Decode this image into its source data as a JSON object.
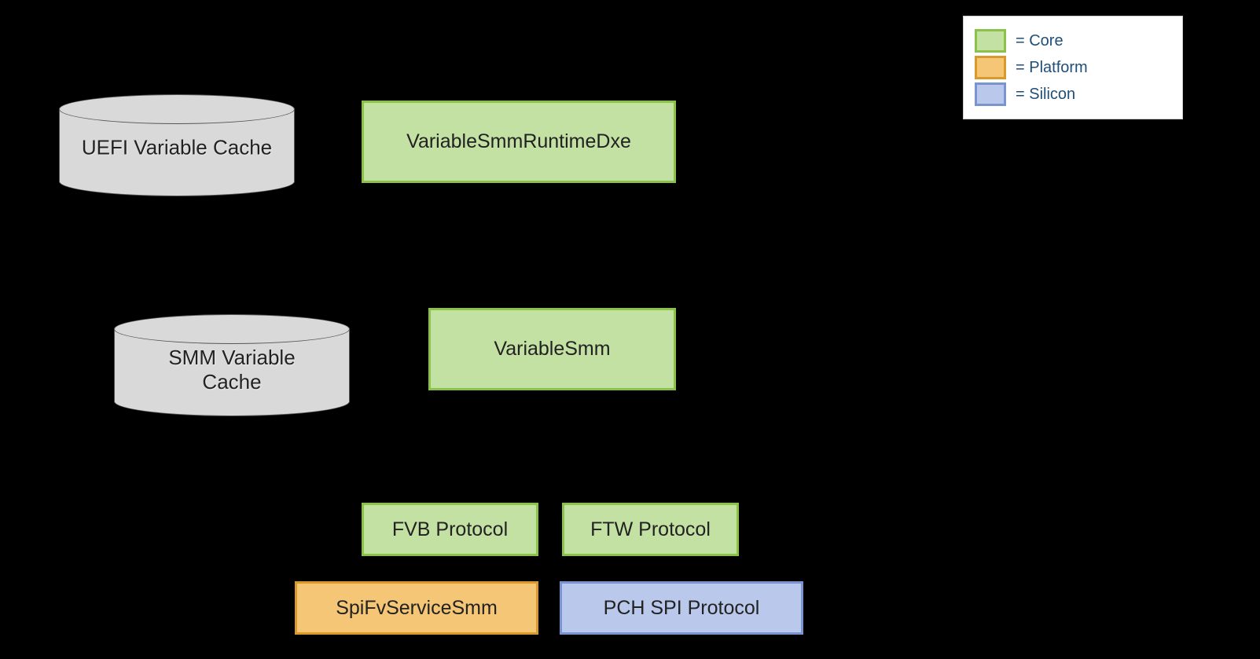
{
  "cylinders": {
    "uefi_cache": "UEFI Variable Cache",
    "smm_cache_line1": "SMM Variable",
    "smm_cache_line2": "Cache"
  },
  "boxes": {
    "var_smm_runtime_dxe": "VariableSmmRuntimeDxe",
    "var_smm": "VariableSmm",
    "fvb_protocol": "FVB Protocol",
    "ftw_protocol": "FTW Protocol",
    "spi_fv_service_smm": "SpiFvServiceSmm",
    "pch_spi_protocol": "PCH SPI Protocol"
  },
  "legend": {
    "core": "= Core",
    "platform": "= Platform",
    "silicon": "= Silicon"
  },
  "colors": {
    "core_fill": "#c4e1a4",
    "core_border": "#8bc34a",
    "platform_fill": "#f6c677",
    "platform_border": "#d99a2b",
    "silicon_fill": "#b9c8eb",
    "silicon_border": "#7a94d0",
    "legend_text": "#1f4e79"
  }
}
